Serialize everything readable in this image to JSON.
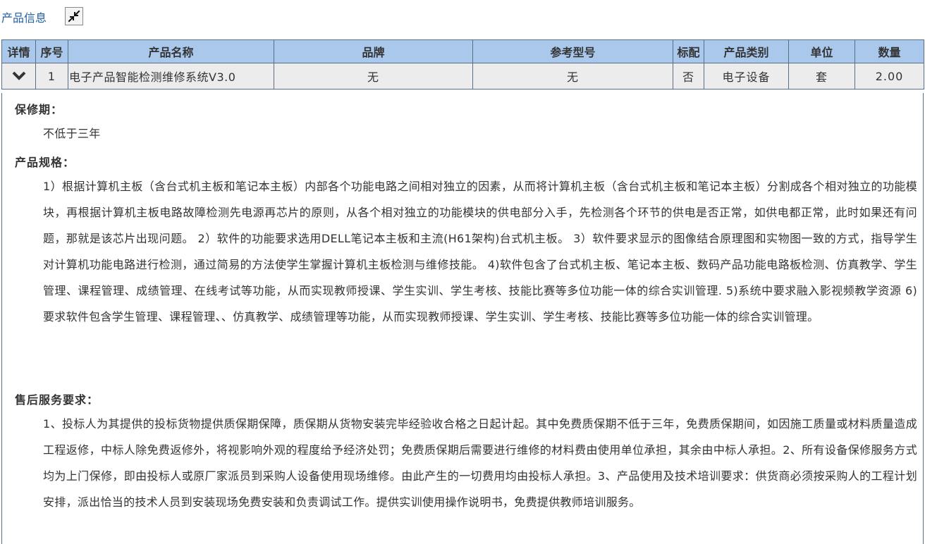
{
  "header": {
    "title": "产品信息",
    "collapse_icon": "collapse-arrows-icon"
  },
  "table": {
    "columns": [
      "详情",
      "序号",
      "产品名称",
      "品牌",
      "参考型号",
      "标配",
      "产品类别",
      "单位",
      "数量"
    ],
    "rows": [
      {
        "detail_icon": "chevron-down-icon",
        "index": "1",
        "name": "电子产品智能检测维修系统V3.0",
        "brand": "无",
        "model": "无",
        "standard": "否",
        "category": "电子设备",
        "unit": "套",
        "quantity": "2.00"
      }
    ]
  },
  "details": {
    "warranty_label": "保修期：",
    "warranty_text": "不低于三年",
    "spec_label": "产品规格：",
    "spec_text": "1）根据计算机主板（含台式机主板和笔记本主板）内部各个功能电路之间相对独立的因素，从而将计算机主板（含台式机主板和笔记本主板）分割成各个相对独立的功能模块，再根据计算机主板电路故障检测先电源再芯片的原则，从各个相对独立的功能模块的供电部分入手，先检测各个环节的供电是否正常，如供电都正常，此时如果还有问题，那就是该芯片出现问题。 2）软件的功能要求选用DELL笔记本主板和主流(H61架构)台式机主板。 3）软件要求显示的图像结合原理图和实物图一致的方式，指导学生对计算机功能电路进行检测，通过简易的方法使学生掌握计算机主板检测与维修技能。 4)软件包含了台式机主板、笔记本主板、数码产品功能电路板检测、仿真教学、学生管理、课程管理、成绩管理、在线考试等功能，从而实现教师授课、学生实训、学生考核、技能比赛等多位功能一体的综合实训管理. 5)系统中要求融入影视频教学资源 6)要求软件包含学生管理、课程管理、、仿真教学、成绩管理等功能，从而实现教师授课、学生实训、学生考核、技能比赛等多位功能一体的综合实训管理。",
    "service_label": "售后服务要求：",
    "service_text": "1、投标人为其提供的投标货物提供质保期保障，质保期从货物安装完毕经验收合格之日起计起。其中免费质保期不低于三年，免费质保期间，如因施工质量或材料质量造成工程返修，中标人除免费返修外，将视影响外观的程度给予经济处罚；免费质保期后需要进行维修的材料费由使用单位承担，其余由中标人承担。2、所有设备保修服务方式均为上门保修，即由投标人或原厂家派员到采购人设备使用现场维修。由此产生的一切费用均由投标人承担。3、产品使用及技术培训要求：供货商必须按采购人的工程计划安排，派出恰当的技术人员到安装现场免费安装和负责调试工作。提供实训使用操作说明书，免费提供教师培训服务。"
  },
  "colors": {
    "header_bg": "#a9c8ec",
    "row_bg": "#ececec",
    "border": "#5a6f86",
    "title_link": "#1f5fa8"
  }
}
